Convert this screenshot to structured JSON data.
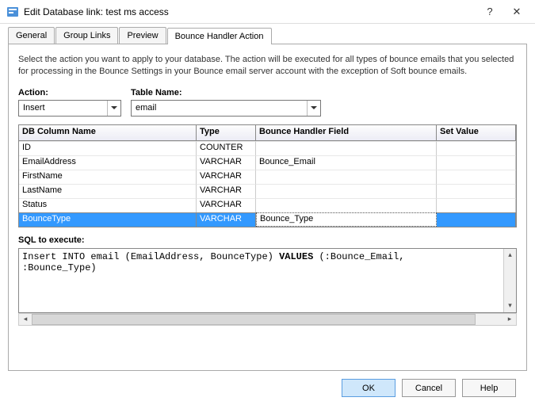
{
  "titlebar": {
    "text": "Edit Database link: test ms access"
  },
  "tabs": [
    "General",
    "Group Links",
    "Preview",
    "Bounce Handler Action"
  ],
  "active_tab": 3,
  "panel": {
    "description": "Select the action you want to apply to your database. The action will be executed for all types of bounce emails that you selected for processing in the Bounce Settings in your Bounce email server account with the exception of Soft bounce emails.",
    "action_label": "Action:",
    "action_value": "Insert",
    "table_label": "Table Name:",
    "table_value": "email",
    "grid_headers": [
      "DB Column Name",
      "Type",
      "Bounce Handler Field",
      "Set Value"
    ],
    "grid_rows": [
      {
        "col1": "ID",
        "col2": "COUNTER",
        "col3": "",
        "col4": "",
        "selected": false
      },
      {
        "col1": "EmailAddress",
        "col2": "VARCHAR",
        "col3": "Bounce_Email",
        "col4": "",
        "selected": false
      },
      {
        "col1": "FirstName",
        "col2": "VARCHAR",
        "col3": "",
        "col4": "",
        "selected": false
      },
      {
        "col1": "LastName",
        "col2": "VARCHAR",
        "col3": "",
        "col4": "",
        "selected": false
      },
      {
        "col1": "Status",
        "col2": "VARCHAR",
        "col3": "",
        "col4": "",
        "selected": false
      },
      {
        "col1": "BounceType",
        "col2": "VARCHAR",
        "col3": "Bounce_Type",
        "col4": "",
        "selected": true
      }
    ],
    "sql_label": "SQL to execute:",
    "sql_line1a": "Insert INTO email (EmailAddress, BounceType) ",
    "sql_kw": "VALUES",
    "sql_line1b": " (:Bounce_Email, ",
    "sql_line2": ":Bounce_Type)"
  },
  "buttons": {
    "ok": "OK",
    "cancel": "Cancel",
    "help": "Help"
  }
}
